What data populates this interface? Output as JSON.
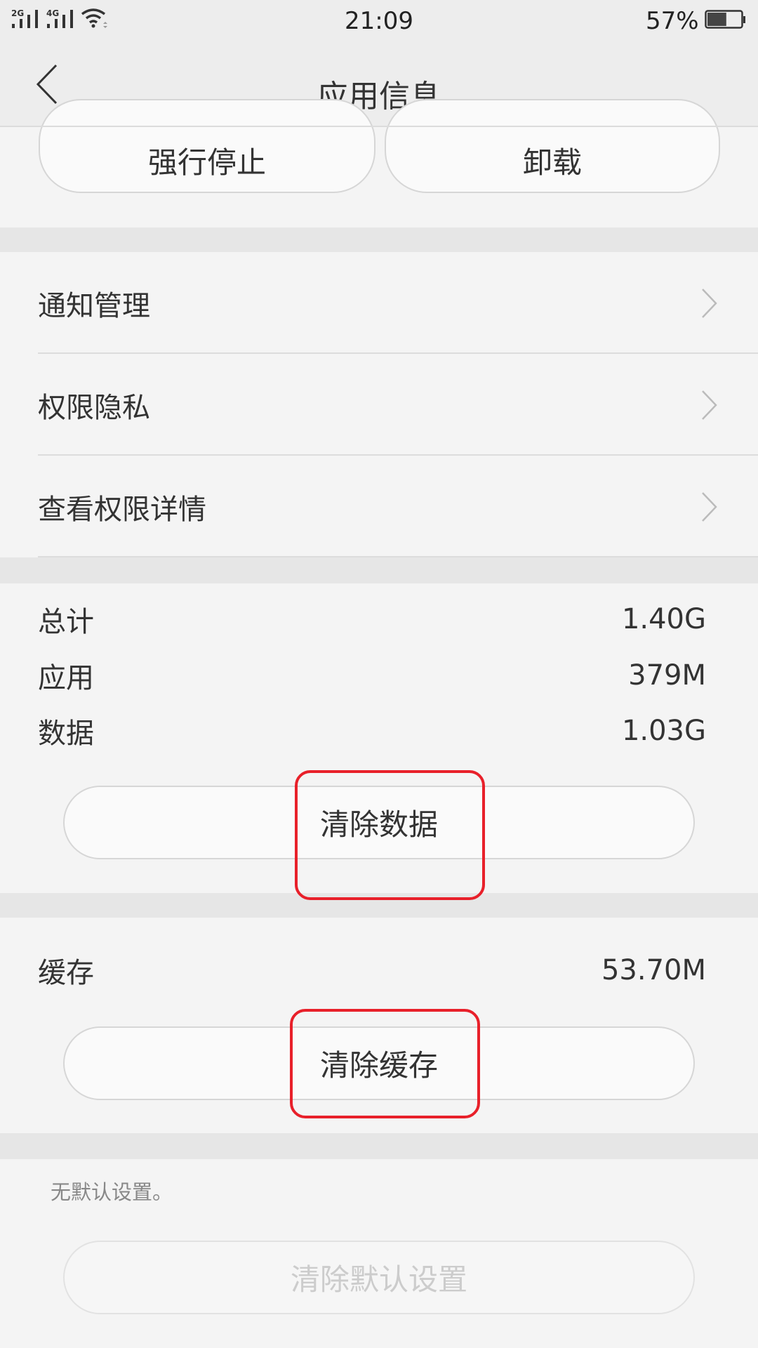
{
  "status_bar": {
    "sim1": "2G",
    "sim2": "4G",
    "time": "21:09",
    "battery_percent": "57%",
    "battery_level": 0.57,
    "icons": [
      "signal-2g-icon",
      "signal-4g-icon",
      "wifi-icon",
      "battery-icon"
    ]
  },
  "header": {
    "title": "应用信息",
    "back_icon": "chevron-left-icon"
  },
  "actions": {
    "force_stop": "强行停止",
    "uninstall": "卸载"
  },
  "menu": {
    "items": [
      {
        "label": "通知管理",
        "icon": "chevron-right-icon"
      },
      {
        "label": "权限隐私",
        "icon": "chevron-right-icon"
      },
      {
        "label": "查看权限详情",
        "icon": "chevron-right-icon"
      }
    ]
  },
  "storage": {
    "rows": [
      {
        "label": "总计",
        "value": "1.40G"
      },
      {
        "label": "应用",
        "value": "379M"
      },
      {
        "label": "数据",
        "value": "1.03G"
      }
    ],
    "clear_data": "清除数据"
  },
  "cache": {
    "label": "缓存",
    "value": "53.70M",
    "clear_cache": "清除缓存"
  },
  "defaults": {
    "note": "无默认设置。",
    "clear_defaults": "清除默认设置"
  },
  "highlight_color": "#e8202a"
}
